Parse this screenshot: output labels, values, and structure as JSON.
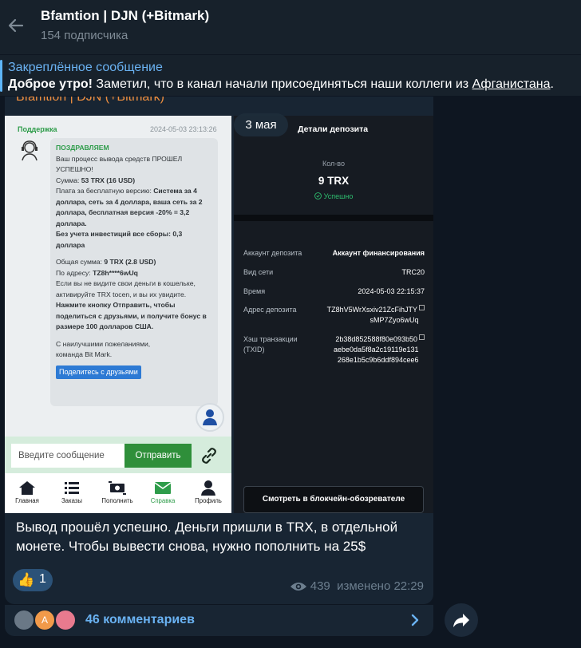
{
  "header": {
    "title": "Bfamtion | DJN (+Bitmark)",
    "subscribers": "154 подписчика"
  },
  "pinned": {
    "label": "Закреплённое сообщение",
    "bold": "Доброе утро!",
    "text": " Заметил, что в канал начали присоединяться наши коллеги из ",
    "link": "Афганистана",
    "end": "."
  },
  "post": {
    "forward_title": "Bfamtion | DJN (+Bitmark)",
    "date_pill": "3 мая",
    "support": {
      "name": "Поддержка",
      "date": "2024-05-03 23:13:26",
      "congrats": "ПОЗДРАВЛЯЕМ",
      "line1": "Ваш процесс вывода средств ПРОШЕЛ УСПЕШНО!",
      "sum_label": "Сумма: ",
      "sum_value": "53 TRX (16 USD)",
      "fee_label": "Плата за бесплатную версию: ",
      "fee_value": "Система за 4 доллара, сеть за 4 доллара, ваша сеть за 2 доллара, бесплатная версия -20% = 3,2 доллара.",
      "total_fees": "Без учета инвестиций все сборы: 0,3 доллара",
      "total_label": "Общая сумма: ",
      "total_value": "9 TRX (2.8 USD)",
      "addr_label": "По адресу: ",
      "addr_value": "TZ8h****6wUq",
      "hint": "Если вы не видите свои деньги в кошельке, активируйте TRX tocen, и вы их увидите.",
      "promo": "Нажмите кнопку Отправить, чтобы поделиться с друзьями, и получите бонус в размере 100 долларов США.",
      "regards1": "С наилучшими пожеланиями,",
      "regards2": "команда Bit Mark.",
      "share": "Поделитесь с друзьями",
      "input_placeholder": "Введите сообщение",
      "send": "Отправить",
      "nav": [
        "Главная",
        "Заказы",
        "Пополнить",
        "Справка",
        "Профиль"
      ]
    },
    "deposit": {
      "title": "Детали депозита",
      "qty_label": "Кол-во",
      "qty": "9 TRX",
      "status": "Успешно",
      "rows": [
        {
          "label": "Аккаунт депозита",
          "value": "Аккаунт финансирования"
        },
        {
          "label": "Вид сети",
          "value": "TRC20"
        },
        {
          "label": "Время",
          "value": "2024-05-03 22:15:37"
        },
        {
          "label": "Адрес депозита",
          "value1": "TZ8hV5WrXsxiv21ZcFihJTY",
          "value2": "sMP7Zyo6wUq"
        },
        {
          "label1": "Хэш транзакции",
          "label2": "(TXID)",
          "value1": "2b38d852588f80e093b50",
          "value2": "aebe0da5f8a2c19119e131",
          "value3": "268e1b5c9b6ddf894cee6"
        }
      ],
      "explorer": "Смотреть в блокчейн-обозревателе"
    },
    "caption": "Вывод прошёл успешно. Деньги пришли в TRX, в отдельной монете. Чтобы вывести снова, нужно пополнить на 25$",
    "reaction": {
      "emoji": "👍",
      "count": "1"
    },
    "views": "439",
    "edited": "изменено 22:29",
    "comments": "46 комментариев",
    "avatar_letter": "A"
  },
  "colors": {
    "background": "#0e1621",
    "bubble": "#182533",
    "accent": "#6ab2f2",
    "green": "#2e9c4a"
  }
}
